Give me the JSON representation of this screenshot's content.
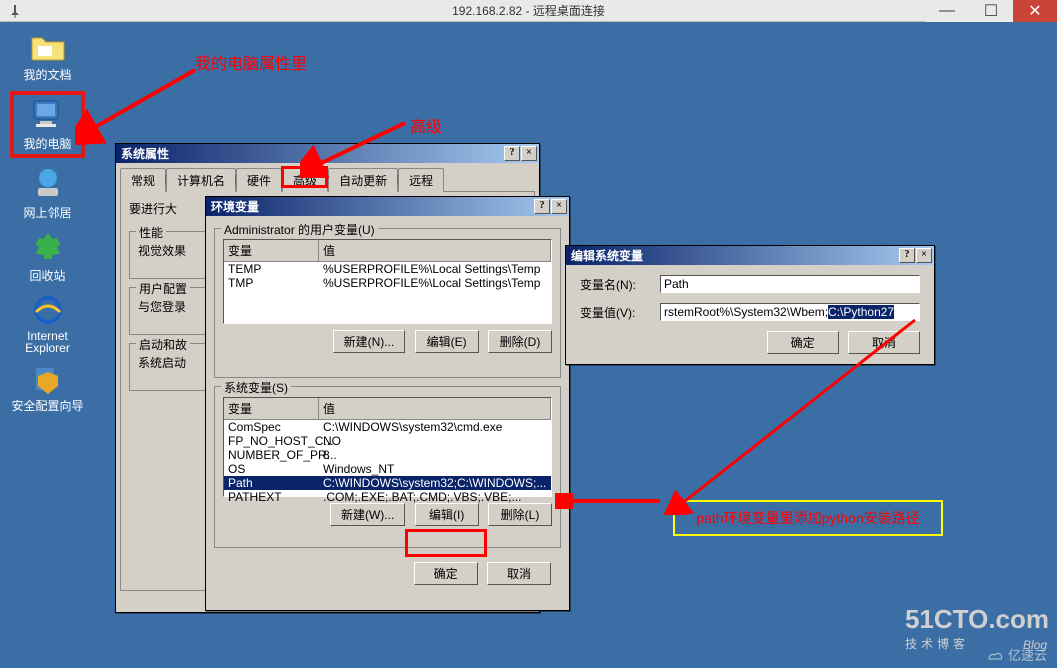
{
  "rdp": {
    "title": "192.168.2.82 - 远程桌面连接"
  },
  "desktop": {
    "icons": [
      "我的文档",
      "我的电脑",
      "网上邻居",
      "回收站",
      "Internet Explorer",
      "安全配置向导"
    ]
  },
  "annotations": {
    "prop": "我的电脑属性里",
    "adv": "高级",
    "path_note": "path环境变量里添加python安装路径"
  },
  "sysprops": {
    "title": "系统属性",
    "tabs": [
      "常规",
      "计算机名",
      "硬件",
      "高级",
      "自动更新",
      "远程"
    ],
    "tip": "要进行大",
    "sec_perf": "性能",
    "perf_desc": "视觉效果",
    "sec_user": "用户配置",
    "user_desc": "与您登录",
    "sec_boot": "启动和故",
    "boot_desc": "系统启动"
  },
  "env": {
    "title": "环境变量",
    "user_legend": "Administrator 的用户变量(U)",
    "sys_legend": "系统变量(S)",
    "col_var": "变量",
    "col_val": "值",
    "user_rows": [
      {
        "name": "TEMP",
        "val": "%USERPROFILE%\\Local Settings\\Temp"
      },
      {
        "name": "TMP",
        "val": "%USERPROFILE%\\Local Settings\\Temp"
      }
    ],
    "sys_rows": [
      {
        "name": "ComSpec",
        "val": "C:\\WINDOWS\\system32\\cmd.exe"
      },
      {
        "name": "FP_NO_HOST_C...",
        "val": "NO"
      },
      {
        "name": "NUMBER_OF_PR...",
        "val": "8"
      },
      {
        "name": "OS",
        "val": "Windows_NT"
      },
      {
        "name": "Path",
        "val": "C:\\WINDOWS\\system32;C:\\WINDOWS;..."
      },
      {
        "name": "PATHEXT",
        "val": ".COM;.EXE;.BAT;.CMD;.VBS;.VBE;..."
      }
    ],
    "btn_new": "新建(N)...",
    "btn_edit": "编辑(E)",
    "btn_del": "删除(D)",
    "btn_new_w": "新建(W)...",
    "btn_edit_i": "编辑(I)",
    "btn_del_l": "删除(L)",
    "ok": "确定",
    "cancel": "取消"
  },
  "editvar": {
    "title": "编辑系统变量",
    "name_label": "变量名(N):",
    "value_label": "变量值(V):",
    "name_value": "Path",
    "val_prefix": "rstemRoot%\\System32\\Wbem;",
    "val_sel": "C:\\Python27",
    "ok": "确定",
    "cancel": "取消"
  },
  "wm": {
    "cto": "51CTO",
    "com": ".com",
    "sub": "技术博客",
    "blog": "Blog",
    "yisu": "亿速云"
  }
}
